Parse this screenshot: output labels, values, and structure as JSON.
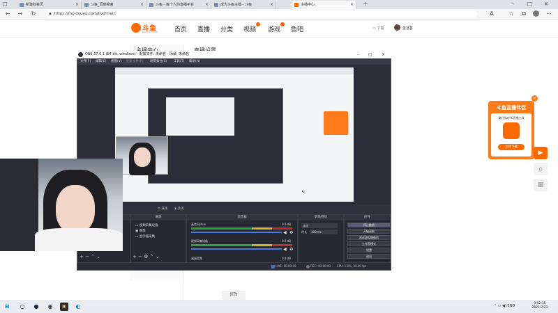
{
  "browser": {
    "tabs": [
      "新建标签页",
      "斗鱼_百度搜索",
      "斗鱼 - 每个人的直播平台",
      "成为斗鱼主播 - 斗鱼",
      "主播中心"
    ],
    "active_tab": 4,
    "url": "https://mp.douyu.com/live/main"
  },
  "site": {
    "logo_name": "斗鱼",
    "logo_sub": "DOUYU.COM",
    "nav": [
      "首页",
      "直播",
      "分类",
      "视频",
      "游戏",
      "鱼吧"
    ],
    "download_label": "下载",
    "user_label": "金禧香"
  },
  "page": {
    "left_heading": "主播中心",
    "main_heading": "直播设置",
    "modify_button": "修改"
  },
  "obs": {
    "title": "OBS 27.0.1 (64 bit, windows) - 配置文件: 未命名 - 场景: 未命名",
    "menu": [
      "文件(F)",
      "编辑(E)",
      "视图(V)",
      "配置文件(P)",
      "场景集合(S)",
      "工具(T)",
      "帮助(H)"
    ],
    "dock_headers": [
      "场景",
      "来源",
      "混音器",
      "转场特效",
      "控件"
    ],
    "sources": [
      "视频采集设备",
      "图像",
      "显示器采集"
    ],
    "mixer": [
      {
        "name": "麦克风/Aux",
        "level": "0.0 dB"
      },
      {
        "name": "视频采集设备",
        "level": "0.0 dB"
      },
      {
        "name": "桌面音频",
        "level": "0.0 dB"
      }
    ],
    "transition": {
      "type": "淡化",
      "duration_label": "时长",
      "duration": "300 ms"
    },
    "controls": [
      "停止推流",
      "开始录制",
      "启动虚拟摄像机",
      "工作室模式",
      "设置",
      "退出"
    ],
    "dock_buttons": [
      "属性",
      "滤镜"
    ],
    "status": [
      "LIVE: 00:00:00",
      "REC: 00:00:00",
      "CPU: 1.0%, 30.00 fps"
    ]
  },
  "promo": {
    "title": "斗鱼直播伴侣",
    "subtitle": "最好用的PC直播工具",
    "download": "立即下载",
    "colors": {
      "brand": "#ff6a00"
    }
  },
  "taskbar": {
    "time": "9:52:15",
    "date": "2021/7/21"
  }
}
